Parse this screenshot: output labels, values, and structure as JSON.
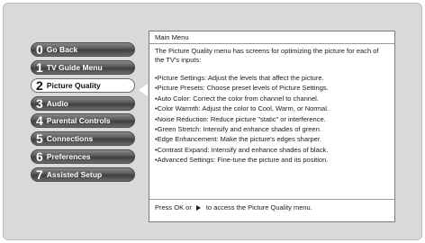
{
  "menu": {
    "items": [
      {
        "number": "0",
        "label": "Go Back",
        "selected": false
      },
      {
        "number": "1",
        "label": "TV Guide Menu",
        "selected": false
      },
      {
        "number": "2",
        "label": "Picture Quality",
        "selected": true
      },
      {
        "number": "3",
        "label": "Audio",
        "selected": false
      },
      {
        "number": "4",
        "label": "Parental Controls",
        "selected": false
      },
      {
        "number": "5",
        "label": "Connections",
        "selected": false
      },
      {
        "number": "6",
        "label": "Preferences",
        "selected": false
      },
      {
        "number": "7",
        "label": "Assisted Setup",
        "selected": false
      }
    ]
  },
  "panel": {
    "title": "Main Menu",
    "intro": "The Picture Quality menu has screens for optimizing the picture for each of the TV's inputs:",
    "items": [
      "•Picture Settings: Adjust the levels that affect the picture.",
      "•Picture Presets: Choose preset levels of Picture Settings.",
      "•Auto Color: Correct the color from channel to channel.",
      "•Color Warmth: Adjust the color to Cool, Warm, or Normal.",
      "•Noise Reduction: Reduce picture \"static\" or interference.",
      "•Green Stretch: Intensify and enhance shades of green.",
      "•Edge Enhancement: Make the picture's edges sharper.",
      "•Contrast Expand: Intensify and enhance shades of black.",
      "•Advanced Settings: Fine-tune the picture and its position."
    ],
    "footer_before": "Press OK or",
    "footer_icon": "right-arrow-icon",
    "footer_after": "to access the Picture Quality menu."
  },
  "colors": {
    "background": "#d9d9d9",
    "button_dark": "#555555",
    "button_selected": "#ffffff"
  }
}
